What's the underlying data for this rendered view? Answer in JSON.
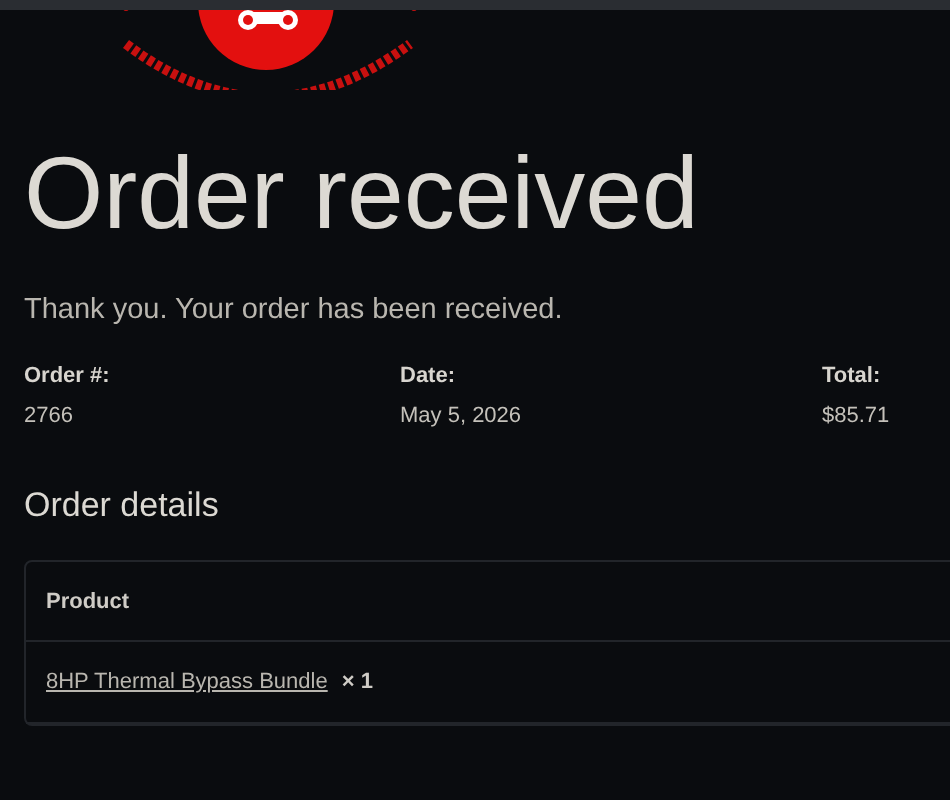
{
  "title": "Order received",
  "message": "Thank you. Your order has been received.",
  "overview": [
    {
      "label": "Order #:",
      "value": "2766"
    },
    {
      "label": "Date:",
      "value": "May 5, 2026"
    },
    {
      "label": "Total:",
      "value": "$85.71"
    }
  ],
  "details": {
    "heading": "Order details",
    "columns": [
      "Product"
    ],
    "rows": [
      {
        "product": "8HP Thermal Bypass Bundle",
        "quantity": "× 1"
      }
    ]
  }
}
